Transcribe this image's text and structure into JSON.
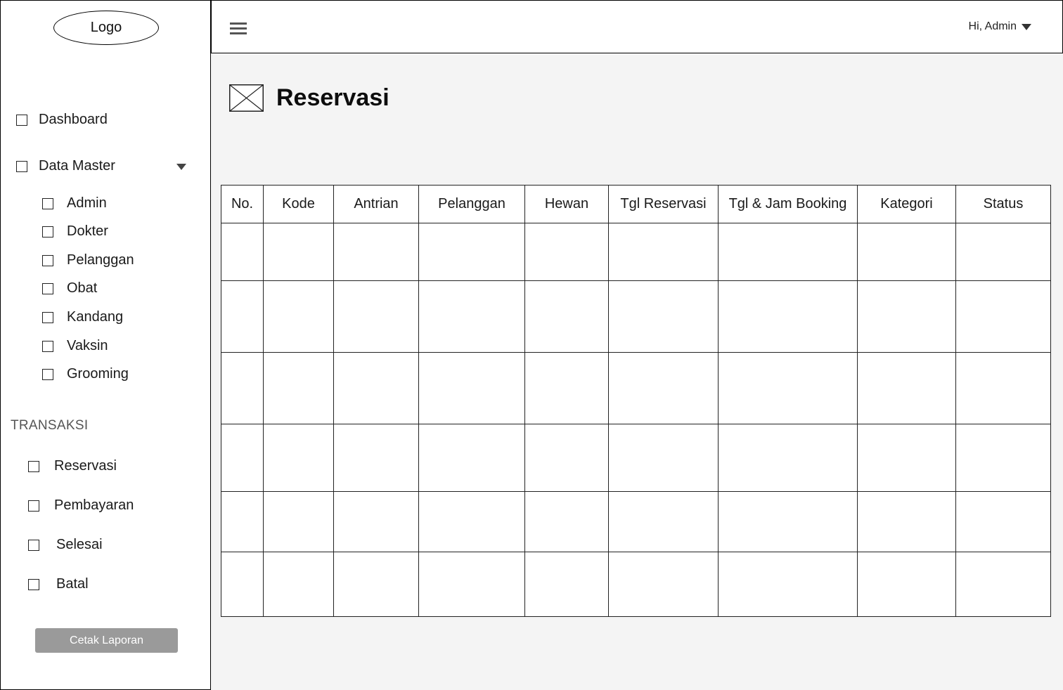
{
  "sidebar": {
    "logo": "Logo",
    "main_items": [
      {
        "label": "Dashboard"
      },
      {
        "label": "Data Master"
      }
    ],
    "master_items": [
      {
        "label": "Admin"
      },
      {
        "label": "Dokter"
      },
      {
        "label": "Pelanggan"
      },
      {
        "label": "Obat"
      },
      {
        "label": "Kandang"
      },
      {
        "label": "Vaksin"
      },
      {
        "label": "Grooming"
      }
    ],
    "transaksi_title": "TRANSAKSI",
    "transaksi_items": [
      {
        "label": "Reservasi"
      },
      {
        "label": "Pembayaran"
      },
      {
        "label": "Selesai"
      },
      {
        "label": "Batal"
      }
    ],
    "report_button": "Cetak Laporan"
  },
  "topbar": {
    "menu_icon": "hamburger-icon",
    "user_greeting": "Hi, Admin"
  },
  "main": {
    "title": "Reservasi",
    "title_icon": "image-placeholder-icon",
    "table": {
      "columns": [
        "No.",
        "Kode",
        "Antrian",
        "Pelanggan",
        "Hewan",
        "Tgl Reservasi",
        "Tgl & Jam Booking",
        "Kategori",
        "Status"
      ],
      "rows": [
        [
          "",
          "",
          "",
          "",
          "",
          "",
          "",
          "",
          ""
        ],
        [
          "",
          "",
          "",
          "",
          "",
          "",
          "",
          "",
          ""
        ],
        [
          "",
          "",
          "",
          "",
          "",
          "",
          "",
          "",
          ""
        ],
        [
          "",
          "",
          "",
          "",
          "",
          "",
          "",
          "",
          ""
        ],
        [
          "",
          "",
          "",
          "",
          "",
          "",
          "",
          "",
          ""
        ],
        [
          "",
          "",
          "",
          "",
          "",
          "",
          "",
          "",
          ""
        ]
      ]
    }
  }
}
